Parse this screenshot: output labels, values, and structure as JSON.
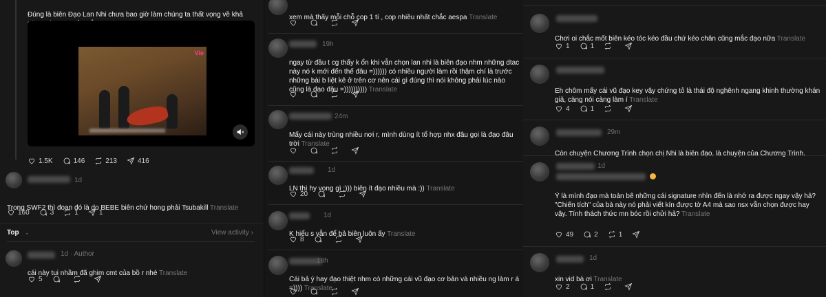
{
  "col1": {
    "post_text": "Đúng là biên Đạo Lan Nhi chưa bao giờ làm chúng ta thất vọng về khả năng sáng tạo của cổ",
    "translate": "Translate",
    "video_logo": "Vie",
    "post_actions": {
      "likes": "1.5K",
      "replies": "146",
      "reposts": "213",
      "shares": "416"
    },
    "reply1": {
      "time": "1d",
      "text": "Trong SWF2 thì đoạn đó là do BEBE biên chứ hong phải Tsubakill",
      "likes": "160",
      "replies": "3",
      "reposts": "1",
      "shares": "1"
    },
    "sort": {
      "label": "Top",
      "view_activity": "View activity"
    },
    "reply2": {
      "time": "1d",
      "author_tag": "· Author",
      "text": "cái này tui nhầm đã ghim cmt của bồ r nhé",
      "likes": "5"
    }
  },
  "col2": {
    "r0": {
      "text": "xem mà thấy mỗi chỗ cop 1 tí , cop nhiều nhất chắc aespa"
    },
    "r1": {
      "time": "19h",
      "text": "ngay từ đầu t cg thấy k ổn khi vẫn chọn lan nhi là biên đạo nhm những dtac này nó k mới đến thế đâu =)))))) có nhiều người làm rồi thậm chí là trước những bài b liệt kê ở trên cơ nên cái gì đúng thì nói không phải lúc nào cũng là đạo đâu =))))))))))"
    },
    "r2": {
      "time": "24m",
      "text": "Mấy cái này trùng nhiều nơi r, mình dùng ít tổ hợp nhx đâu gọi là đạo đâu trời"
    },
    "r3": {
      "time": "1d",
      "text": "LN thì hy vọng gì :))) biên ít đạo nhiều mà :))",
      "likes": "20"
    },
    "r4": {
      "time": "1d",
      "text": "K hiểu s vẫn để bả biên luôn ấy",
      "likes": "8"
    },
    "r5": {
      "time": "18h",
      "text": "Cái bả ý hay đạo thiệt nhm có những cái vũ đạo cơ bản và nhiều ng làm r á =))))"
    },
    "translate": "Translate"
  },
  "col3": {
    "r1": {
      "text": "Chơi oi chắc mốt biên kéo tóc kéo đầu chứ kéo chân cũng mắc đạo nữa",
      "likes": "1",
      "replies": "1"
    },
    "r2": {
      "text": "Eh chôm mấy cái vũ đạo key vậy chứng tỏ là thái độ nghênh ngang khinh thường khán giả, càng nói càng làm í",
      "likes": "4",
      "replies": "1"
    },
    "r3": {
      "time": "29m",
      "text": "Còn chuyện Chương Trình chọn chị Nhi là biên đạo, là chuyện của Chương Trình."
    },
    "r4": {
      "time": "1d",
      "text": "Ý là mình đạo mà toàn bê những cái signature nhìn đến là nhớ ra được ngay vậy hả?\n\"Chiến tích\" của bà này nó phải viết kín được tờ A4 mà sao nsx vẫn chọn được hay vậy. Tính thách thức mn bóc rồi chửi hả?",
      "likes": "49",
      "replies": "2",
      "reposts": "1"
    },
    "r5": {
      "time": "1d",
      "text": "xin vid bà ơi",
      "likes": "2",
      "replies": "1"
    },
    "translate": "Translate"
  },
  "colors": {
    "bg": "#181818",
    "text": "#f3f5f7",
    "muted": "#777777",
    "reaction_emoji": "#f4b63c"
  },
  "icons": [
    "heart-icon",
    "comment-icon",
    "repost-icon",
    "share-icon",
    "mute-icon",
    "chevron-down-icon",
    "chevron-right-icon"
  ]
}
